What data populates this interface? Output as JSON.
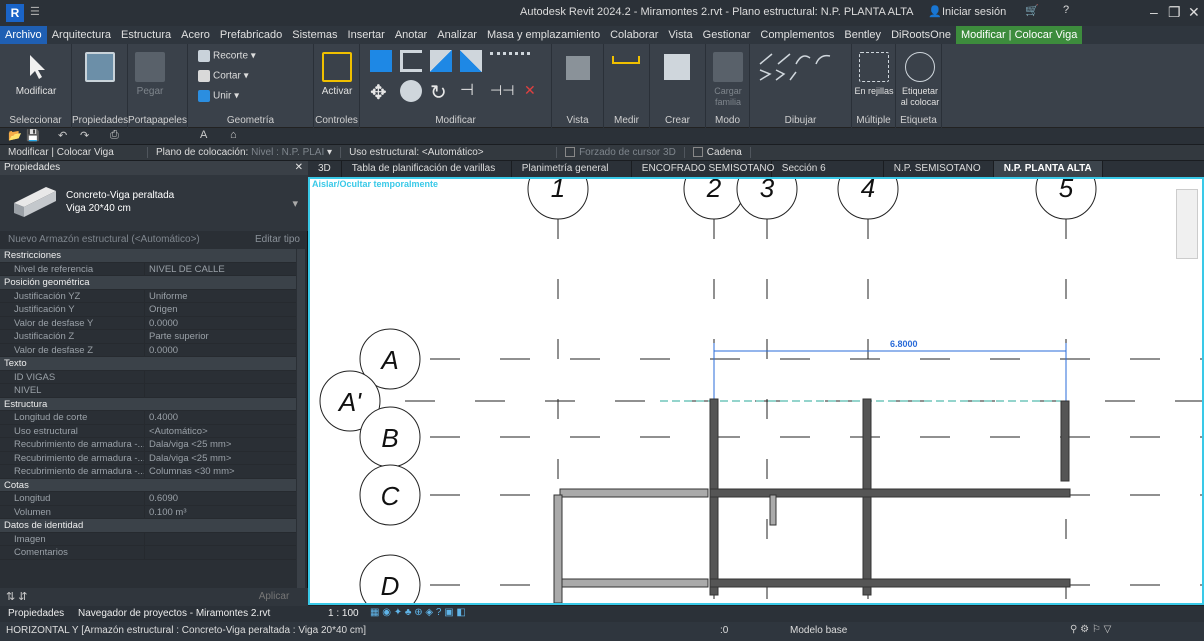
{
  "app": {
    "logo": "R",
    "title": "Autodesk Revit 2024.2 - Miramontes 2.rvt - Plano estructural: N.P. PLANTA ALTA",
    "signin": "Iniciar sesión"
  },
  "menu": [
    "Archivo",
    "Arquitectura",
    "Estructura",
    "Acero",
    "Prefabricado",
    "Sistemas",
    "Insertar",
    "Anotar",
    "Analizar",
    "Masa y emplazamiento",
    "Colaborar",
    "Vista",
    "Gestionar",
    "Complementos",
    "Bentley",
    "DiRootsOne",
    "Modificar | Colocar Viga"
  ],
  "ribbon": {
    "modify": "Modificar",
    "paste": "Pegar",
    "cut": "Recorte",
    "cut2": "Cortar",
    "join": "Unir",
    "activate": "Activar",
    "load": "Cargar familia",
    "in_grid": "En rejillas",
    "tag": "Etiquetar al colocar",
    "groups": [
      "Seleccionar",
      "Propiedades",
      "Portapapeles",
      "Geometría",
      "Controles",
      "Modificar",
      "Vista",
      "Medir",
      "Crear",
      "Modo",
      "Dibujar",
      "Múltiple",
      "Etiqueta"
    ]
  },
  "options": {
    "context": "Modificar | Colocar Viga",
    "plane_label": "Plano de colocación:",
    "plane_value": "Nivel : N.P. PLAI",
    "usage_label": "Uso estructural:",
    "usage_value": "<Automático>",
    "snap3d": "Forzado de cursor 3D",
    "chain": "Cadena"
  },
  "props": {
    "header": "Propiedades",
    "type1": "Concreto-Viga peraltada",
    "type2": "Viga 20*40 cm",
    "new": "Nuevo Armazón estructural (<Automático>)",
    "edit_type": "Editar tipo",
    "rows": [
      {
        "cat": "Restricciones"
      },
      {
        "k": "Nivel de referencia",
        "v": "NIVEL DE CALLE"
      },
      {
        "cat": "Posición geométrica"
      },
      {
        "k": "Justificación YZ",
        "v": "Uniforme"
      },
      {
        "k": "Justificación Y",
        "v": "Origen"
      },
      {
        "k": "Valor de desfase Y",
        "v": "0.0000"
      },
      {
        "k": "Justificación Z",
        "v": "Parte superior"
      },
      {
        "k": "Valor de desfase Z",
        "v": "0.0000"
      },
      {
        "cat": "Texto"
      },
      {
        "k": "ID VIGAS",
        "v": ""
      },
      {
        "k": "NIVEL",
        "v": ""
      },
      {
        "cat": "Estructura"
      },
      {
        "k": "Longitud de corte",
        "v": "0.4000"
      },
      {
        "k": "Uso estructural",
        "v": "<Automático>"
      },
      {
        "k": "Recubrimiento de armadura -...",
        "v": "Dala/viga <25 mm>"
      },
      {
        "k": "Recubrimiento de armadura -...",
        "v": "Dala/viga <25 mm>"
      },
      {
        "k": "Recubrimiento de armadura -...",
        "v": "Columnas <30 mm>"
      },
      {
        "cat": "Cotas"
      },
      {
        "k": "Longitud",
        "v": "0.6090"
      },
      {
        "k": "Volumen",
        "v": "0.100 m³"
      },
      {
        "cat": "Datos de identidad"
      },
      {
        "k": "Imagen",
        "v": ""
      },
      {
        "k": "Comentarios",
        "v": ""
      }
    ],
    "apply": "Aplicar"
  },
  "tabs": [
    "3D",
    "Tabla de planificación de varillas",
    "Planimetría general",
    "ENCOFRADO SEMISOTANO",
    "Sección 6",
    "N.P. SEMISOTANO",
    "N.P. PLANTA ALTA"
  ],
  "canvas": {
    "banner": "Aislar/Ocultar temporalmente",
    "grid_v": [
      "1",
      "2",
      "3",
      "4",
      "5"
    ],
    "grid_h": [
      "A",
      "A'",
      "B",
      "C",
      "D"
    ],
    "dim": "6.8000"
  },
  "bottom": {
    "props_tab": "Propiedades",
    "browser_tab": "Navegador de proyectos - Miramontes 2.rvt",
    "scale": "1 : 100"
  },
  "status": {
    "text": "HORIZONTAL Y [Armazón estructural : Concreto-Viga peraltada : Viga 20*40 cm]",
    "zero": ":0",
    "model": "Modelo base"
  }
}
